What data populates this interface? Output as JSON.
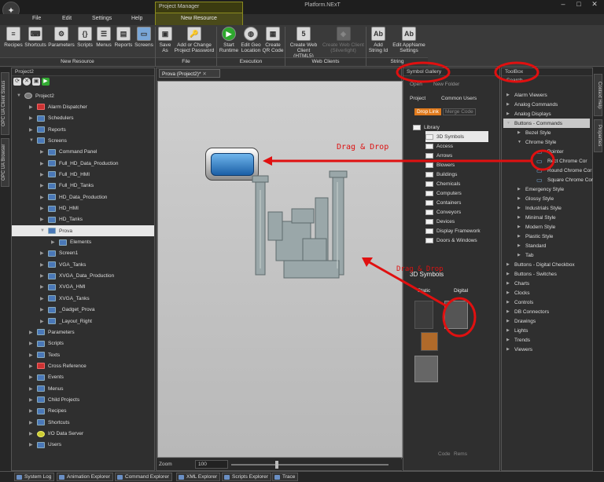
{
  "window": {
    "app_title": "Platform.NExT",
    "context_tab": "Project Manager"
  },
  "menu": {
    "items": [
      "File",
      "Edit",
      "Settings",
      "Help"
    ],
    "active_tab": "New Resource"
  },
  "ribbon": {
    "groups": [
      {
        "label": "New Resource",
        "buttons": [
          {
            "label": "Recipes",
            "icon": "recipes-icon"
          },
          {
            "label": "Shortcuts",
            "icon": "shortcuts-icon"
          },
          {
            "label": "Parameters",
            "icon": "parameters-icon"
          },
          {
            "label": "Scripts",
            "icon": "scripts-icon"
          },
          {
            "label": "Menus",
            "icon": "menus-icon"
          },
          {
            "label": "Reports",
            "icon": "reports-icon"
          },
          {
            "label": "Screens",
            "icon": "screens-icon"
          }
        ]
      },
      {
        "label": "File",
        "buttons": [
          {
            "label": "Save As",
            "icon": "save-icon"
          },
          {
            "label": "Add or Change Project Password",
            "icon": "password-icon"
          }
        ]
      },
      {
        "label": "Execution",
        "buttons": [
          {
            "label": "Start Runtime",
            "icon": "start-icon"
          },
          {
            "label": "Edit Geo Location",
            "icon": "globe-icon"
          },
          {
            "label": "Create QR Code",
            "icon": "qr-icon"
          }
        ]
      },
      {
        "label": "Web Clients",
        "buttons": [
          {
            "label": "Create Web Client (HTML5)",
            "icon": "html5-icon"
          },
          {
            "label": "Create Web Client (Silverlight)",
            "icon": "silverlight-icon",
            "disabled": true
          }
        ]
      },
      {
        "label": "String",
        "buttons": [
          {
            "label": "Add String Id",
            "icon": "add-string-icon"
          },
          {
            "label": "Edit AppName Settings",
            "icon": "appname-icon"
          }
        ]
      }
    ]
  },
  "left_rail": {
    "tabs": [
      "OPC UA Client Status",
      "OPC UA Browser"
    ]
  },
  "project_panel": {
    "title": "Project2",
    "tree": [
      {
        "label": "Project2",
        "level": 0,
        "icon": "gear"
      },
      {
        "label": "Alarm Dispatcher",
        "level": 1,
        "icon": "red"
      },
      {
        "label": "Schedulers",
        "level": 1,
        "icon": "blue"
      },
      {
        "label": "Reports",
        "level": 1,
        "icon": "blue"
      },
      {
        "label": "Screens",
        "level": 1,
        "icon": "blue"
      },
      {
        "label": "Command Panel",
        "level": 2,
        "icon": "blue"
      },
      {
        "label": "Full_HD_Data_Production",
        "level": 2,
        "icon": "blue"
      },
      {
        "label": "Full_HD_HMI",
        "level": 2,
        "icon": "blue"
      },
      {
        "label": "Full_HD_Tanks",
        "level": 2,
        "icon": "blue"
      },
      {
        "label": "HD_Data_Production",
        "level": 2,
        "icon": "blue"
      },
      {
        "label": "HD_HMI",
        "level": 2,
        "icon": "blue"
      },
      {
        "label": "HD_Tanks",
        "level": 2,
        "icon": "blue"
      },
      {
        "label": "Prova",
        "level": 2,
        "icon": "blue",
        "selected": true
      },
      {
        "label": "Elements",
        "level": 3,
        "icon": "blue"
      },
      {
        "label": "Screen1",
        "level": 2,
        "icon": "blue"
      },
      {
        "label": "VGA_Tanks",
        "level": 2,
        "icon": "blue"
      },
      {
        "label": "XVGA_Data_Production",
        "level": 2,
        "icon": "blue"
      },
      {
        "label": "XVGA_HMI",
        "level": 2,
        "icon": "blue"
      },
      {
        "label": "XVGA_Tanks",
        "level": 2,
        "icon": "blue"
      },
      {
        "label": "_Gadget_Prova",
        "level": 2,
        "icon": "blue"
      },
      {
        "label": "_Layout_Right",
        "level": 2,
        "icon": "blue"
      },
      {
        "label": "Parameters",
        "level": 1,
        "icon": "blue"
      },
      {
        "label": "Scripts",
        "level": 1,
        "icon": "blue"
      },
      {
        "label": "Texts",
        "level": 1,
        "icon": "blue"
      },
      {
        "label": "Cross Reference",
        "level": 1,
        "icon": "red"
      },
      {
        "label": "Events",
        "level": 1,
        "icon": "blue"
      },
      {
        "label": "Menus",
        "level": 1,
        "icon": "blue"
      },
      {
        "label": "Child Projects",
        "level": 1,
        "icon": "blue"
      },
      {
        "label": "Recipes",
        "level": 1,
        "icon": "blue"
      },
      {
        "label": "Shortcuts",
        "level": 1,
        "icon": "blue"
      },
      {
        "label": "I/O Data Server",
        "level": 1,
        "icon": "yel"
      },
      {
        "label": "Users",
        "level": 1,
        "icon": "blue"
      }
    ]
  },
  "document": {
    "tab": "Prova (Project2)*",
    "zoom_label": "Zoom",
    "zoom_value": "100"
  },
  "symbol_gallery": {
    "title": "Symbol Gallery",
    "toolbar": [
      "Open",
      "New Folder"
    ],
    "tabs": [
      "Project",
      "Common Users"
    ],
    "actions": [
      "Drop Link",
      "Merge Code"
    ],
    "folders": [
      "Library",
      "3D Symbols",
      "Access",
      "Arrows",
      "Blowers",
      "Buildings",
      "Chemicals",
      "Computers",
      "Containers",
      "Conveyors",
      "Devices",
      "Display Framework",
      "Doors & Windows"
    ],
    "symbols_title": "3D Symbols",
    "symbol_tabs": [
      "Static",
      "Digital"
    ],
    "footer": [
      "Code",
      "Rems"
    ]
  },
  "toolbox": {
    "title": "ToolBox",
    "search_tab": "Search",
    "items": [
      {
        "label": "Alarm Viewers",
        "level": 0
      },
      {
        "label": "Analog Commands",
        "level": 0
      },
      {
        "label": "Analog Displays",
        "level": 0
      },
      {
        "label": "Buttons - Commands",
        "level": 0,
        "highlight": true
      },
      {
        "label": "Bezel Style",
        "level": 1
      },
      {
        "label": "Chrome Style",
        "level": 1
      },
      {
        "label": "Pointer",
        "level": 2
      },
      {
        "label": "Rect Chrome Cor",
        "level": 2
      },
      {
        "label": "Round Chrome Cor",
        "level": 2
      },
      {
        "label": "Square Chrome Cor",
        "level": 2
      },
      {
        "label": "Emergency Style",
        "level": 1
      },
      {
        "label": "Glossy Style",
        "level": 1
      },
      {
        "label": "Industrials Style",
        "level": 1
      },
      {
        "label": "Minimal Style",
        "level": 1
      },
      {
        "label": "Modern Style",
        "level": 1
      },
      {
        "label": "Plastic Style",
        "level": 1
      },
      {
        "label": "Standard",
        "level": 1
      },
      {
        "label": "Tab",
        "level": 1
      },
      {
        "label": "Buttons - Digital Checkbox",
        "level": 0
      },
      {
        "label": "Buttons - Switches",
        "level": 0
      },
      {
        "label": "Charts",
        "level": 0
      },
      {
        "label": "Clocks",
        "level": 0
      },
      {
        "label": "Controls",
        "level": 0
      },
      {
        "label": "DB Connectors",
        "level": 0
      },
      {
        "label": "Drawings",
        "level": 0
      },
      {
        "label": "Lights",
        "level": 0
      },
      {
        "label": "Trends",
        "level": 0
      },
      {
        "label": "Viewers",
        "level": 0
      }
    ]
  },
  "right_rail": {
    "tabs": [
      "Context Help",
      "Properties"
    ]
  },
  "annotations": {
    "drag1": "Drag & Drop",
    "drag2": "Drag & Drop"
  },
  "statusbar": {
    "tabs": [
      "System Log",
      "Animation Explorer",
      "Command Explorer",
      "XML Explorer",
      "Scripts Explorer",
      "Trace"
    ]
  }
}
